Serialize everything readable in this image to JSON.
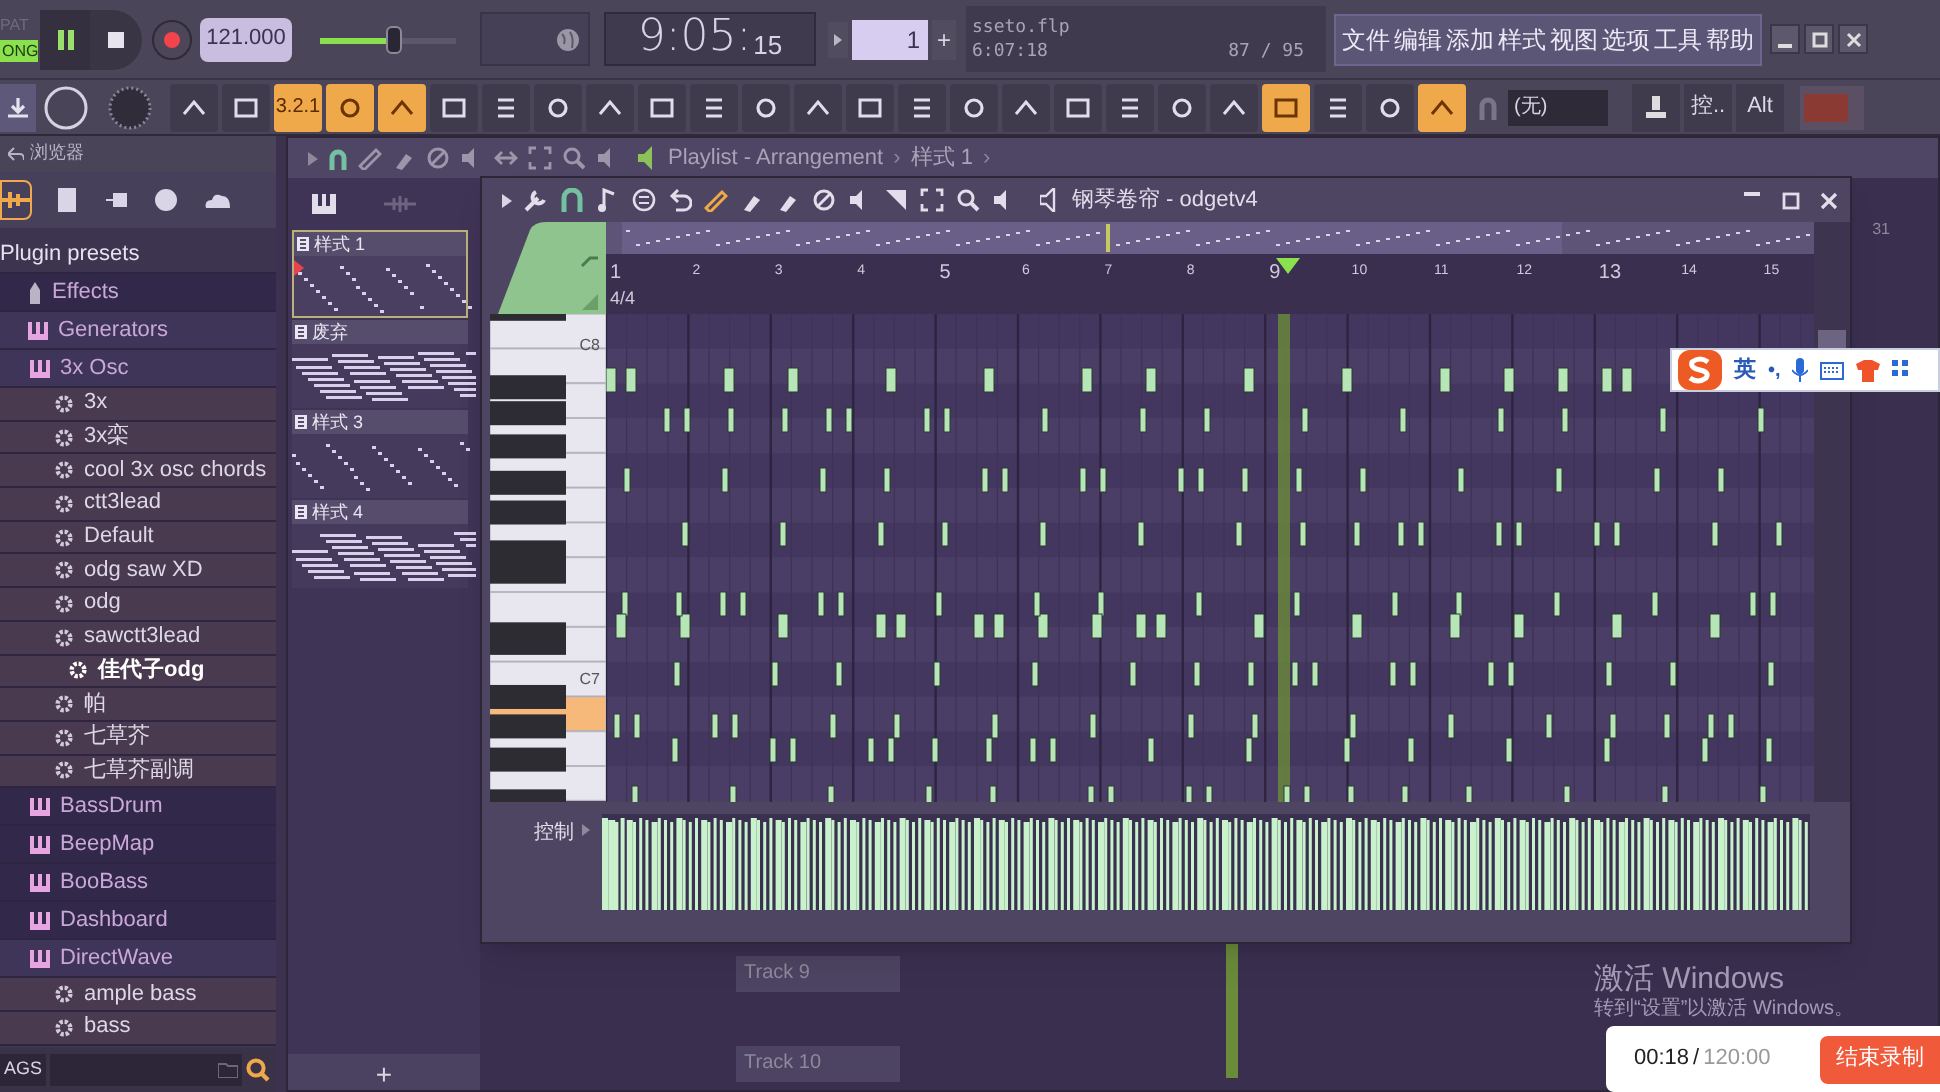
{
  "transport": {
    "pat_label": "PAT",
    "song_label": "ONG",
    "song_selected": true,
    "tempo": "121.000",
    "master_volume": {
      "level": 0.55
    },
    "time_main": "9:05:",
    "time_sub": "15",
    "pattern_number": "1",
    "pattern_add": "+"
  },
  "hint_panel": {
    "file": "sseto.flp",
    "duration": "6:07:18",
    "count": "87 / 95"
  },
  "menu": [
    "文件",
    "编辑",
    "添加",
    "样式",
    "视图",
    "选项",
    "工具",
    "帮助"
  ],
  "toolbar": [
    {
      "on": false
    },
    {
      "on": false
    },
    {
      "on": true,
      "label": "3.2.1"
    },
    {
      "on": true
    },
    {
      "on": true
    },
    {
      "on": false
    },
    {
      "on": false
    },
    {
      "on": false
    },
    {
      "on": false
    },
    {
      "on": false
    },
    {
      "on": false
    },
    {
      "on": false
    },
    {
      "on": false
    },
    {
      "on": false
    },
    {
      "on": false
    },
    {
      "on": false
    },
    {
      "on": false
    },
    {
      "on": false
    },
    {
      "on": false
    },
    {
      "on": false
    },
    {
      "on": false
    },
    {
      "on": true
    },
    {
      "on": false
    },
    {
      "on": false
    },
    {
      "on": true
    }
  ],
  "snap": {
    "value": "(无)"
  },
  "toolbar_right": [
    {
      "label": "控.."
    },
    {
      "label": "Alt"
    }
  ],
  "browser": {
    "title": "浏览器",
    "tags_label": "AGS",
    "tabs": [
      {
        "selected": true
      },
      {
        "selected": false
      },
      {
        "selected": false
      },
      {
        "selected": false
      },
      {
        "selected": false
      }
    ],
    "tree": [
      {
        "kind": "folder",
        "label": "Plugin presets",
        "expanded": true,
        "children": [
          {
            "kind": "effects",
            "label": "Effects",
            "expanded": false
          },
          {
            "kind": "plugin",
            "label": "Generators",
            "expanded": true,
            "children": [
              {
                "kind": "plugin",
                "label": "3x Osc",
                "expanded": true,
                "children": [
                  {
                    "kind": "preset",
                    "label": "3x",
                    "selected": false
                  },
                  {
                    "kind": "preset",
                    "label": "3x栾",
                    "selected": false
                  },
                  {
                    "kind": "preset",
                    "label": "cool 3x osc chords",
                    "selected": false
                  },
                  {
                    "kind": "preset",
                    "label": "ctt3lead",
                    "selected": false
                  },
                  {
                    "kind": "preset",
                    "label": "Default",
                    "selected": false
                  },
                  {
                    "kind": "preset",
                    "label": "odg saw XD",
                    "selected": false
                  },
                  {
                    "kind": "preset",
                    "label": "odg",
                    "selected": false
                  },
                  {
                    "kind": "preset",
                    "label": "sawctt3lead",
                    "selected": false
                  },
                  {
                    "kind": "preset",
                    "label": "佳代子odg",
                    "selected": true
                  },
                  {
                    "kind": "preset",
                    "label": "帕",
                    "selected": false
                  },
                  {
                    "kind": "preset",
                    "label": "七草芥",
                    "selected": false
                  },
                  {
                    "kind": "preset",
                    "label": "七草芥副调",
                    "selected": false
                  }
                ]
              },
              {
                "kind": "plugin",
                "label": "BassDrum",
                "expanded": false
              },
              {
                "kind": "plugin",
                "label": "BeepMap",
                "expanded": false
              },
              {
                "kind": "plugin",
                "label": "BooBass",
                "expanded": false
              },
              {
                "kind": "plugin",
                "label": "Dashboard",
                "expanded": false
              },
              {
                "kind": "plugin",
                "label": "DirectWave",
                "expanded": true,
                "children": [
                  {
                    "kind": "preset",
                    "label": "ample bass",
                    "selected": false
                  },
                  {
                    "kind": "preset",
                    "label": "bass",
                    "selected": false
                  }
                ]
              }
            ]
          }
        ]
      }
    ]
  },
  "playlist": {
    "title": "Playlist - Arrangement",
    "separator": "›",
    "pattern": "样式 1",
    "bar_number": "31",
    "patterns": [
      {
        "label": "样式 1",
        "selected": true
      },
      {
        "label": "废弃",
        "selected": false
      },
      {
        "label": "样式 3",
        "selected": false
      },
      {
        "label": "样式 4",
        "selected": false
      }
    ],
    "add": "+",
    "tracks": [
      "Track 9",
      "Track 10"
    ]
  },
  "piano_roll": {
    "title": "钢琴卷帘 - odgetv4",
    "ruler": [
      "1",
      "2",
      "3",
      "4",
      "5",
      "6",
      "7",
      "8",
      "9",
      "10",
      "11",
      "12",
      "13",
      "14",
      "15"
    ],
    "time_signature": "4/4",
    "keys": [
      "C8",
      "C7"
    ],
    "control_label": "控制"
  },
  "ime_bar": {
    "mode": "英",
    "punct": "•,"
  },
  "recorder": {
    "elapsed": "00:18",
    "separator": "/",
    "total": "120:00",
    "stop": "结束录制"
  },
  "os_notice": {
    "title": "激活 Windows",
    "text": "转到“设置”以激活 Windows。"
  }
}
